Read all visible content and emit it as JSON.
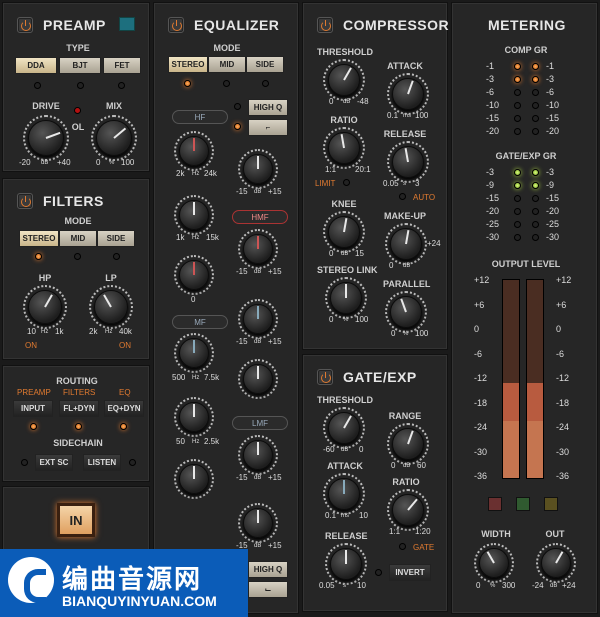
{
  "preamp": {
    "title": "PREAMP",
    "type_label": "TYPE",
    "types": [
      "DDA",
      "BJT",
      "FET"
    ],
    "drive_label": "DRIVE",
    "ol_label": "OL",
    "mix_label": "MIX",
    "drive_min": "-20",
    "drive_unit": "dB",
    "drive_max": "+40",
    "mix_min": "0",
    "mix_unit": "%",
    "mix_max": "100"
  },
  "filters": {
    "title": "FILTERS",
    "mode_label": "MODE",
    "modes": [
      "STEREO",
      "MID",
      "SIDE"
    ],
    "hp_label": "HP",
    "lp_label": "LP",
    "hp_min": "10",
    "hp_unit": "Hz",
    "hp_max": "1k",
    "lp_min": "2k",
    "lp_unit": "Hz",
    "lp_max": "40k",
    "hp_on": "ON",
    "lp_on": "ON"
  },
  "routing": {
    "title": "ROUTING",
    "cols": [
      "PREAMP",
      "FILTERS",
      "EQ"
    ],
    "buttons": [
      "INPUT",
      "FL+DYN",
      "EQ+DYN"
    ],
    "sidechain_label": "SIDECHAIN",
    "sc_buttons": [
      "EXT SC",
      "LISTEN"
    ]
  },
  "in_button": "IN",
  "eq": {
    "title": "EQUALIZER",
    "mode_label": "MODE",
    "modes": [
      "STEREO",
      "MID",
      "SIDE"
    ],
    "high_q": "HIGH Q",
    "bands": [
      "HF",
      "HMF",
      "MF",
      "LMF"
    ],
    "freq_rows": [
      [
        "2k",
        "Hz",
        "24k"
      ],
      [
        "1k",
        "Hz",
        "15k"
      ],
      [
        "",
        "",
        ""
      ],
      [
        "500",
        "Hz",
        "7.5k"
      ],
      [
        "50",
        "Hz",
        "2.5k"
      ]
    ],
    "gain_min": "-15",
    "gain_unit": "dB",
    "gain_max": "+15",
    "q_row": [
      "0"
    ],
    "high_q_bottom": "HIGH Q"
  },
  "compressor": {
    "title": "COMPRESSOR",
    "threshold": "THRESHOLD",
    "th_range": [
      "0",
      "dB",
      "-48"
    ],
    "attack": "ATTACK",
    "at_range": [
      "0.1",
      "ms",
      "100"
    ],
    "ratio": "RATIO",
    "ra_range": [
      "1:1",
      "",
      "20:1"
    ],
    "release": "RELEASE",
    "re_range": [
      "0.05",
      "s",
      "3"
    ],
    "limit": "LIMIT",
    "auto": "AUTO",
    "knee": "KNEE",
    "kn_range": [
      "0",
      "dB",
      "15"
    ],
    "makeup": "MAKE-UP",
    "mu_range": [
      "0",
      "dB",
      "+24"
    ],
    "link": "STEREO LINK",
    "li_range": [
      "0",
      "%",
      "100"
    ],
    "parallel": "PARALLEL",
    "pa_range": [
      "0",
      "%",
      "100"
    ]
  },
  "gate": {
    "title": "GATE/EXP",
    "threshold": "THRESHOLD",
    "th_range": [
      "-60",
      "dB",
      "0"
    ],
    "range": "RANGE",
    "rg_range": [
      "0",
      "dB",
      "60"
    ],
    "attack": "ATTACK",
    "at_range": [
      "0.1",
      "ms",
      "10"
    ],
    "ratio": "RATIO",
    "ra_range": [
      "1:1",
      "",
      "1:20"
    ],
    "release": "RELEASE",
    "re_range": [
      "0.05",
      "s",
      "10"
    ],
    "gate_label": "GATE",
    "invert": "INVERT"
  },
  "metering": {
    "title": "METERING",
    "comp_gr": "COMP GR",
    "comp_scale": [
      "-1",
      "-3",
      "-6",
      "-10",
      "-15",
      "-20"
    ],
    "gate_gr": "GATE/EXP GR",
    "gate_scale": [
      "-3",
      "-9",
      "-15",
      "-20",
      "-25",
      "-30"
    ],
    "output_level": "OUTPUT LEVEL",
    "out_scale_l": [
      "+12",
      "+6",
      "0",
      "-6",
      "-12",
      "-18",
      "-24",
      "-30",
      "-36"
    ],
    "out_scale_r": [
      "+12",
      "+6",
      "0",
      "-6",
      "-12",
      "-18",
      "-24",
      "-30",
      "-36"
    ],
    "width": "WIDTH",
    "out": "OUT",
    "width_range": [
      "0",
      "%",
      "300"
    ],
    "out_range": [
      "-24",
      "dB",
      "+24"
    ],
    "level": 0.48
  },
  "watermark": {
    "cn": "编曲音源网",
    "en": "BIANQUYINYUAN.COM"
  },
  "colors": {
    "accent": "#e07a30",
    "panel": "#262626"
  }
}
